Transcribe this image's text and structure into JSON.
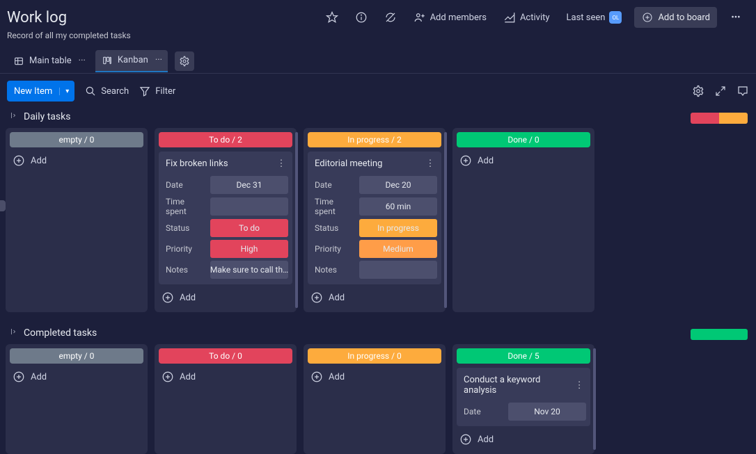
{
  "header": {
    "title": "Work log",
    "subtitle": "Record of all my completed tasks",
    "add_members": "Add members",
    "activity": "Activity",
    "last_seen": "Last seen",
    "avatar_initials": "OL",
    "add_to_board": "Add to board"
  },
  "views": {
    "main_table": "Main table",
    "kanban": "Kanban"
  },
  "toolbar": {
    "new_item": "New Item",
    "search": "Search",
    "filter": "Filter"
  },
  "groups": [
    {
      "name": "Daily tasks",
      "summary": [
        {
          "color": "#e2445c",
          "width": 50
        },
        {
          "color": "#fdab3d",
          "width": 50
        }
      ],
      "columns": [
        {
          "label": "empty / 0",
          "bg": "#6e7a8a",
          "cards": [],
          "add": "Add"
        },
        {
          "label": "To do / 2",
          "bg": "#e2445c",
          "scroll": true,
          "cards": [
            {
              "title": "Fix broken links",
              "fields": [
                {
                  "label": "Date",
                  "value": "Dec 31",
                  "bg": "#4c4f6d"
                },
                {
                  "label": "Time spent",
                  "value": "",
                  "bg": "#4c4f6d"
                },
                {
                  "label": "Status",
                  "value": "To do",
                  "bg": "#e2445c"
                },
                {
                  "label": "Priority",
                  "value": "High",
                  "bg": "#e2445c"
                },
                {
                  "label": "Notes",
                  "value": "Make sure to call th…",
                  "bg": "#4c4f6d"
                }
              ]
            }
          ],
          "add": "Add"
        },
        {
          "label": "In progress / 2",
          "bg": "#fdab3d",
          "scroll": true,
          "cards": [
            {
              "title": "Editorial meeting",
              "fields": [
                {
                  "label": "Date",
                  "value": "Dec 20",
                  "bg": "#4c4f6d"
                },
                {
                  "label": "Time spent",
                  "value": "60 min",
                  "bg": "#4c4f6d"
                },
                {
                  "label": "Status",
                  "value": "In progress",
                  "bg": "#fdab3d"
                },
                {
                  "label": "Priority",
                  "value": "Medium",
                  "bg": "#ff9d48"
                },
                {
                  "label": "Notes",
                  "value": "",
                  "bg": "#4c4f6d"
                }
              ]
            }
          ],
          "add": "Add"
        },
        {
          "label": "Done / 0",
          "bg": "#00c875",
          "cards": [],
          "add": "Add"
        }
      ]
    },
    {
      "name": "Completed tasks",
      "summary": [
        {
          "color": "#00c875",
          "width": 100
        }
      ],
      "columns": [
        {
          "label": "empty / 0",
          "bg": "#6e7a8a",
          "cards": [],
          "add": "Add"
        },
        {
          "label": "To do / 0",
          "bg": "#e2445c",
          "cards": [],
          "add": "Add"
        },
        {
          "label": "In progress / 0",
          "bg": "#fdab3d",
          "cards": [],
          "add": "Add"
        },
        {
          "label": "Done / 5",
          "bg": "#00c875",
          "scroll": true,
          "cards": [
            {
              "title": "Conduct a keyword analysis",
              "fields": [
                {
                  "label": "Date",
                  "value": "Nov 20",
                  "bg": "#4c4f6d"
                }
              ]
            }
          ],
          "add": "Add"
        }
      ]
    }
  ]
}
